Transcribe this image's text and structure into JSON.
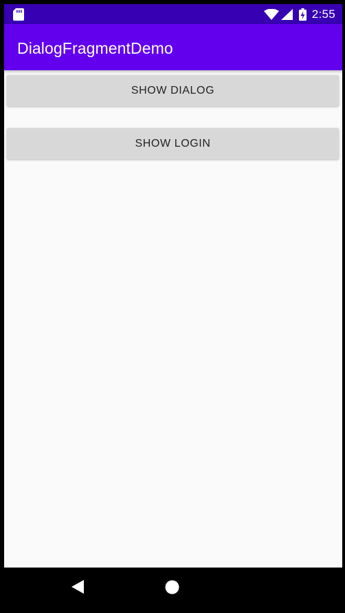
{
  "status_bar": {
    "time": "2:55",
    "icons": [
      "sd-card-icon",
      "wifi-icon",
      "signal-icon",
      "battery-charging-icon"
    ],
    "background": "#3700b3"
  },
  "app_bar": {
    "title": "DialogFragmentDemo",
    "background": "#6200ee"
  },
  "main": {
    "buttons": [
      {
        "label": "SHOW DIALOG"
      },
      {
        "label": "SHOW LOGIN"
      }
    ],
    "background": "#fafafa",
    "button_color": "#d7d8d7"
  },
  "nav_bar": {
    "icons": [
      "back-icon",
      "home-icon"
    ],
    "background": "#000000"
  }
}
